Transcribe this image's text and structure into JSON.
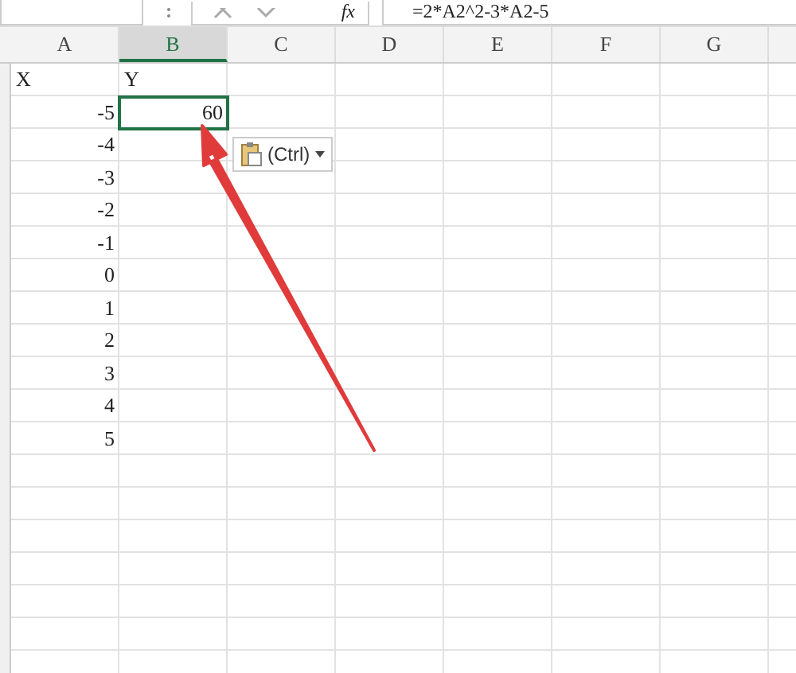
{
  "formula_bar": {
    "function_label": "fx",
    "formula": "=2*A2^2-3*A2-5"
  },
  "columns": [
    {
      "label": "A",
      "selected": false
    },
    {
      "label": "B",
      "selected": true
    },
    {
      "label": "C",
      "selected": false
    },
    {
      "label": "D",
      "selected": false
    },
    {
      "label": "E",
      "selected": false
    },
    {
      "label": "F",
      "selected": false
    },
    {
      "label": "G",
      "selected": false
    }
  ],
  "rows": [
    [
      {
        "text": "X",
        "selected": false
      },
      {
        "text": "Y",
        "selected": false
      }
    ],
    [
      {
        "text": "-5",
        "selected": false
      },
      {
        "text": "60",
        "selected": true
      }
    ],
    [
      {
        "text": "-4",
        "selected": false
      }
    ],
    [
      {
        "text": "-3",
        "selected": false
      }
    ],
    [
      {
        "text": "-2",
        "selected": false
      }
    ],
    [
      {
        "text": "-1",
        "selected": false
      }
    ],
    [
      {
        "text": "0",
        "selected": false
      }
    ],
    [
      {
        "text": "1",
        "selected": false
      }
    ],
    [
      {
        "text": "2",
        "selected": false
      }
    ],
    [
      {
        "text": "3",
        "selected": false
      }
    ],
    [
      {
        "text": "4",
        "selected": false
      }
    ],
    [
      {
        "text": "5",
        "selected": false
      }
    ]
  ],
  "paste_options": {
    "label": "(Ctrl)"
  }
}
